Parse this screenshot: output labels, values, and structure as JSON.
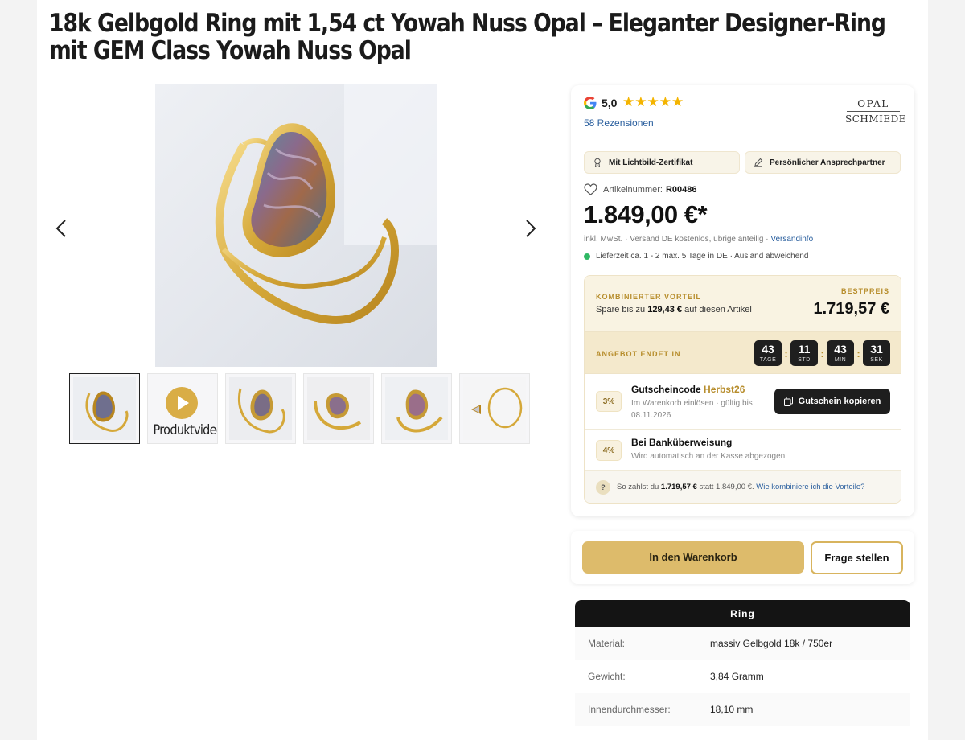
{
  "product": {
    "title": "18k Gelbgold Ring mit 1,54 ct Yowah Nuss Opal – Eleganter Designer-Ring mit GEM Class Yowah Nuss Opal"
  },
  "gallery": {
    "video_label": "Produktvideo",
    "thumb_count": 6
  },
  "reviews": {
    "score": "5,0",
    "stars": "★★★★★",
    "count_text": "58 Rezensionen"
  },
  "brand": {
    "line1": "OPAL",
    "line2": "SCHMIEDE"
  },
  "badges": {
    "certificate": "Mit Lichtbild-Zertifikat",
    "contact": "Persönlicher Ansprechpartner"
  },
  "article": {
    "label": "Artikelnummer:",
    "number": "R00486"
  },
  "price": {
    "value": "1.849,00 €*",
    "tax_text": "inkl. MwSt. · Versand DE kostenlos, übrige anteilig · ",
    "tax_link": "Versandinfo",
    "delivery": "Lieferzeit ca. 1 - 2 max. 5 Tage in DE · Ausland abweichend"
  },
  "combo": {
    "label": "KOMBINIERTER VORTEIL",
    "save_prefix": "Spare bis zu ",
    "save_amount": "129,43 €",
    "save_suffix": " auf diesen Artikel",
    "best_label": "BESTPREIS",
    "best_price": "1.719,57 €",
    "timer_label": "ANGEBOT ENDET IN",
    "timer": [
      {
        "value": "43",
        "unit": "TAGE"
      },
      {
        "value": "11",
        "unit": "STD"
      },
      {
        "value": "43",
        "unit": "MIN"
      },
      {
        "value": "31",
        "unit": "SEK"
      }
    ],
    "coupon": {
      "percent": "3%",
      "title": "Gutscheincode ",
      "code": "Herbst26",
      "sub1": "Im Warenkorb einlösen · gültig bis",
      "sub2": "08.11.2026",
      "button": "Gutschein kopieren"
    },
    "bank": {
      "percent": "4%",
      "title": "Bei Banküberweisung",
      "sub": "Wird automatisch an der Kasse abgezogen"
    },
    "footer": {
      "q": "?",
      "prefix": "So zahlst du ",
      "final": "1.719,57 €",
      "middle": " statt 1.849,00 €. ",
      "link": "Wie kombiniere ich die Vorteile?"
    }
  },
  "actions": {
    "cart": "In den Warenkorb",
    "ask": "Frage stellen"
  },
  "spec": {
    "heading": "Ring",
    "rows": [
      {
        "key": "Material:",
        "value": "massiv Gelbgold 18k / 750er"
      },
      {
        "key": "Gewicht:",
        "value": "3,84 Gramm"
      },
      {
        "key": "Innendurchmesser:",
        "value": "18,10 mm"
      }
    ]
  },
  "colors": {
    "gold": "#ddbb6b",
    "accent": "#b78d2c",
    "dark": "#1e1e1e",
    "link": "#2a5f9e",
    "green": "#2fb864"
  }
}
